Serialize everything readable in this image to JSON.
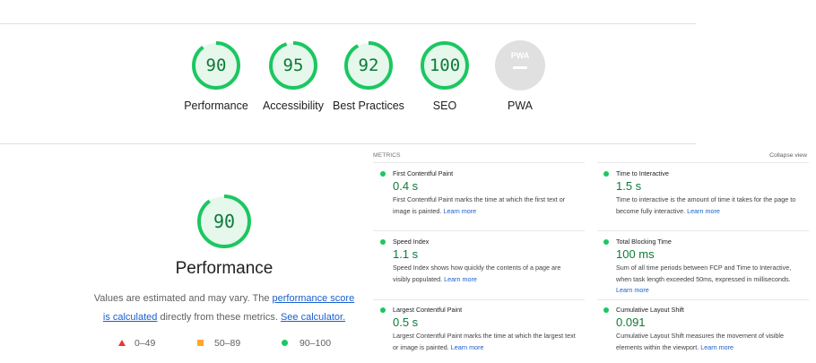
{
  "summary": {
    "gauges": [
      {
        "score": "90",
        "label": "Performance",
        "value": 90
      },
      {
        "score": "95",
        "label": "Accessibility",
        "value": 95
      },
      {
        "score": "92",
        "label": "Best Practices",
        "value": 92
      },
      {
        "score": "100",
        "label": "SEO",
        "value": 100
      }
    ],
    "pwa": {
      "badge_text": "PWA",
      "label": "PWA"
    }
  },
  "performance": {
    "score": "90",
    "value": 90,
    "title": "Performance",
    "note_prefix": "Values are estimated and may vary. The ",
    "note_link1": "performance score is calculated",
    "note_middle": " directly from these metrics. ",
    "note_link2": "See calculator.",
    "legend": {
      "fail": "0–49",
      "average": "50–89",
      "pass": "90–100"
    }
  },
  "metrics": {
    "header": "METRICS",
    "collapse": "Collapse view",
    "items": [
      {
        "name": "First Contentful Paint",
        "value": "0.4 s",
        "desc": "First Contentful Paint marks the time at which the first text or image is painted.",
        "link": "Learn more"
      },
      {
        "name": "Time to Interactive",
        "value": "1.5 s",
        "desc": "Time to interactive is the amount of time it takes for the page to become fully interactive.",
        "link": "Learn more"
      },
      {
        "name": "Speed Index",
        "value": "1.1 s",
        "desc": "Speed Index shows how quickly the contents of a page are visibly populated.",
        "link": "Learn more"
      },
      {
        "name": "Total Blocking Time",
        "value": "100 ms",
        "desc": "Sum of all time periods between FCP and Time to Interactive, when task length exceeded 50ms, expressed in milliseconds.",
        "link": "Learn more"
      },
      {
        "name": "Largest Contentful Paint",
        "value": "0.5 s",
        "desc": "Largest Contentful Paint marks the time at which the largest text or image is painted.",
        "link": "Learn more"
      },
      {
        "name": "Cumulative Layout Shift",
        "value": "0.091",
        "desc": "Cumulative Layout Shift measures the movement of visible elements within the viewport.",
        "link": "Learn more"
      }
    ]
  },
  "colors": {
    "pass": "#0c7a38",
    "pass_ring": "#1bc760",
    "pass_bg": "#e6f7ec",
    "average": "#ffa726",
    "fail": "#e53935",
    "link": "#1a5fd0"
  }
}
